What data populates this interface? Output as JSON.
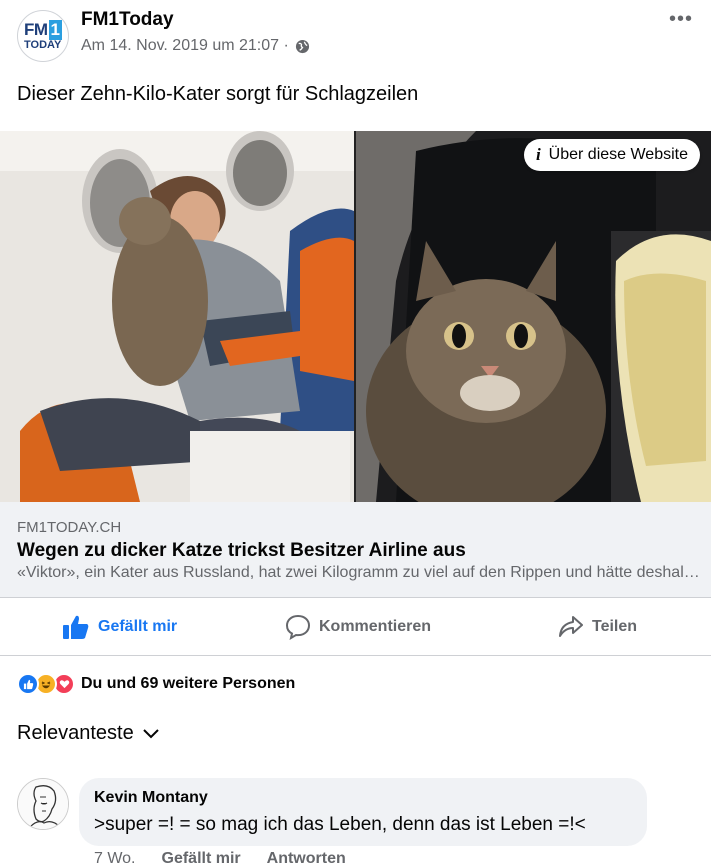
{
  "post": {
    "page_name": "FM1Today",
    "avatar_logo": "FM1 TODAY",
    "timestamp": "Am 14. Nov. 2019 um 21:07 ·",
    "text": "Dieser Zehn-Kilo-Kater sorgt für Schlagzeilen",
    "more_icon": "ellipsis-icon",
    "privacy_icon": "globe-icon"
  },
  "media": {
    "about_chip": "Über diese Website",
    "about_icon": "info-icon"
  },
  "link": {
    "domain": "FM1TODAY.CH",
    "title": "Wegen zu dicker Katze trickst Besitzer Airline aus",
    "description": "«Viktor», ein Kater aus Russland, hat zwei Kilogramm zu viel auf den Rippen und hätte deshalb nicht in die Kabine gedurft."
  },
  "actions": {
    "like": "Gefällt mir",
    "comment": "Kommentieren",
    "share": "Teilen"
  },
  "reactions": {
    "text": "Du und 69 weitere Personen",
    "icons": [
      "like-icon",
      "haha-icon",
      "love-icon"
    ]
  },
  "comments_sort": "Relevanteste",
  "comment": {
    "author": "Kevin Montany",
    "text": ">super =! = so mag ich das Leben, denn  das ist Leben =!<",
    "time": "7 Wo.",
    "like": "Gefällt mir",
    "reply": "Antworten"
  },
  "colors": {
    "accent": "#1877f2",
    "secondary_text": "#65676b",
    "link_bg": "#f0f2f5"
  }
}
